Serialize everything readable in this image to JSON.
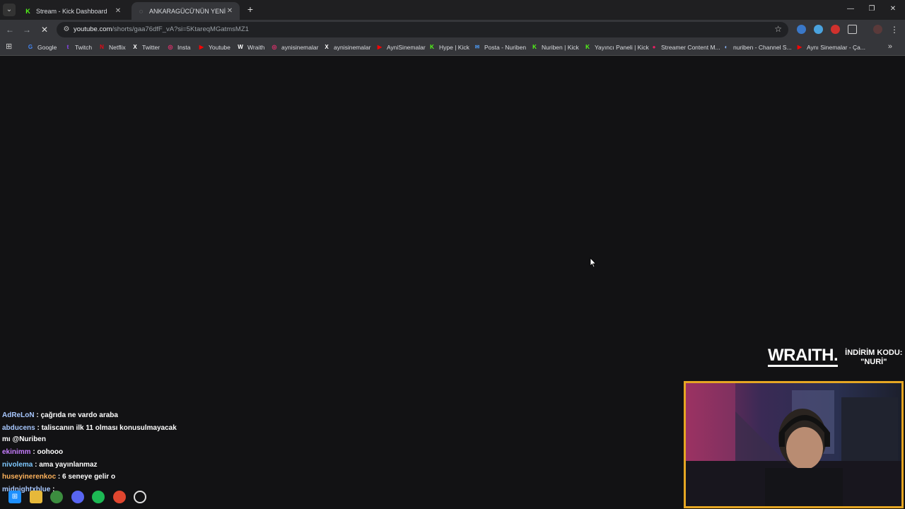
{
  "tabs": [
    {
      "title": "Stream - Kick Dashboard",
      "favicon": "kick-icon",
      "active": false
    },
    {
      "title": "ANKARAGÜCÜ'NÜN YENİ BAŞK",
      "favicon": "loading-icon",
      "active": true
    }
  ],
  "address_bar": {
    "url_host": "youtube.com",
    "url_rest": "/shorts/gaa76dfF_vA?si=5KtareqMGatmsMZ1"
  },
  "bookmarks": [
    {
      "label": "Google",
      "icon": "google-icon",
      "color": "#4285f4"
    },
    {
      "label": "Twitch",
      "icon": "twitch-icon",
      "color": "#9146ff"
    },
    {
      "label": "Netflix",
      "icon": "netflix-icon",
      "color": "#e50914"
    },
    {
      "label": "Twitter",
      "icon": "x-icon",
      "color": "#ffffff"
    },
    {
      "label": "Insta",
      "icon": "instagram-icon",
      "color": "#e1306c"
    },
    {
      "label": "Youtube",
      "icon": "youtube-icon",
      "color": "#ff0000"
    },
    {
      "label": "Wraith",
      "icon": "wraith-icon",
      "color": "#ffffff"
    },
    {
      "label": "aynisinemalar",
      "icon": "instagram-icon",
      "color": "#e1306c"
    },
    {
      "label": "aynisinemalar",
      "icon": "x-icon",
      "color": "#ffffff"
    },
    {
      "label": "AyniSinemalar",
      "icon": "youtube-icon",
      "color": "#ff0000"
    },
    {
      "label": "Hype | Kick",
      "icon": "kick-icon",
      "color": "#53fc18"
    },
    {
      "label": "Posta - Nuriben",
      "icon": "mail-icon",
      "color": "#4a90e2"
    },
    {
      "label": "Nuriben | Kick",
      "icon": "kick-icon",
      "color": "#53fc18"
    },
    {
      "label": "Yayıncı Paneli | Kick",
      "icon": "kick-icon",
      "color": "#53fc18"
    },
    {
      "label": "Streamer Content M...",
      "icon": "streamer-icon",
      "color": "#e91e63"
    },
    {
      "label": "nuriben - Channel S...",
      "icon": "globe-icon",
      "color": "#8ab4f8"
    },
    {
      "label": "Aynı Sinemalar - Ça...",
      "icon": "youtube-icon",
      "color": "#ff0000"
    }
  ],
  "overlay": {
    "brand": "WRAITH.",
    "promo_line1": "İNDİRİM KODU:",
    "promo_line2": "\"NURİ\""
  },
  "chat": [
    {
      "user": "AdReLoN",
      "user_color": "#a8c8ff",
      "message": " : çağrıda ne vardo araba"
    },
    {
      "user": "abducens",
      "user_color": "#a8c8ff",
      "message": " : taliscanın ilk 11 olması konusulmayacak"
    },
    {
      "user": "",
      "user_color": "#ffffff",
      "message": "mı @Nuriben"
    },
    {
      "user": "ekinimm",
      "user_color": "#c77dff",
      "message": " : oohooo"
    },
    {
      "user": "nivolema",
      "user_color": "#7ec8ff",
      "message": " : ama yayınlanmaz"
    },
    {
      "user": "huseyinerenkoc",
      "user_color": "#ffb35c",
      "message": " : 6 seneye gelir o"
    },
    {
      "user": "midnightxblue",
      "user_color": "#a8c8ff",
      "message": " :"
    }
  ],
  "colors": {
    "cam_border": "#e5a623",
    "page_bg": "#121214"
  }
}
